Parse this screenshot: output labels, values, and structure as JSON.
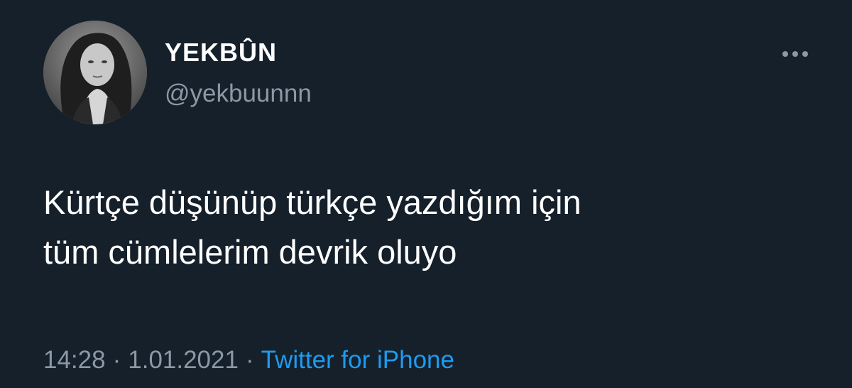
{
  "user": {
    "display_name": "YEKBÛN",
    "handle": "@yekbuunnn",
    "avatar_icon": "profile-photo"
  },
  "more_menu": {
    "icon": "more-horizontal-icon"
  },
  "tweet": {
    "text": "Kürtçe düşünüp türkçe yazdığım için\ntüm cümlelerim devrik oluyo"
  },
  "meta": {
    "time": "14:28",
    "separator": "·",
    "date": "1.01.2021",
    "source": "Twitter for iPhone"
  },
  "colors": {
    "background": "#15202b",
    "text": "#ffffff",
    "secondary": "#8b98a5",
    "link": "#1d9bf0"
  }
}
